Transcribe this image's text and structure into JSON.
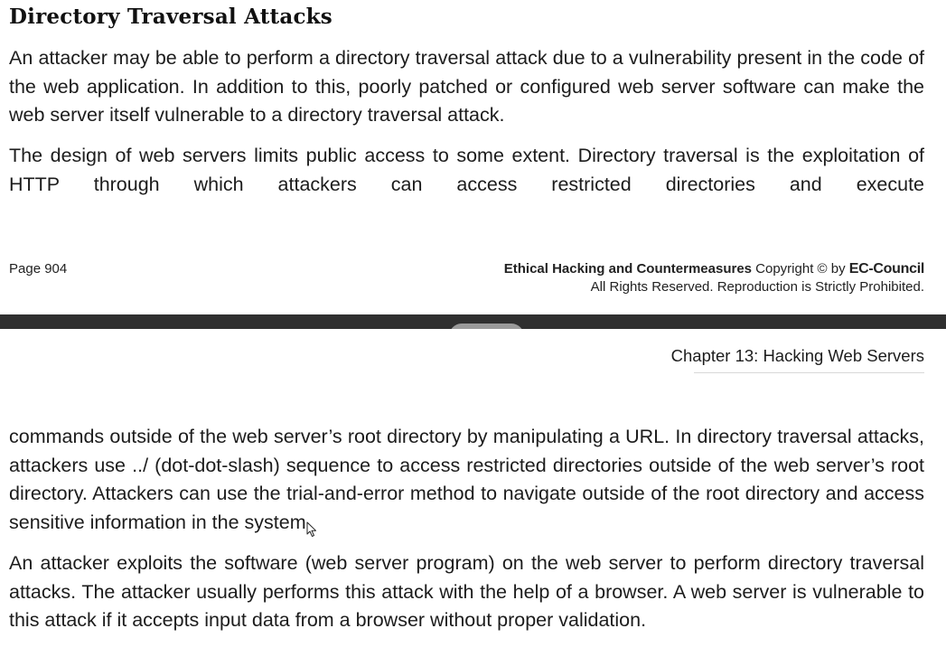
{
  "top_page": {
    "heading": "Directory Traversal Attacks",
    "paragraph_1": "An attacker may be able to perform a directory traversal attack due to a vulnerability present in the code of the web application. In addition to this, poorly patched or configured web server software can make the web server itself vulnerable to a directory traversal attack.",
    "paragraph_2": "The design of web servers limits public access to some extent. Directory traversal is the exploitation of HTTP through which attackers can access restricted directories and execute",
    "footer": {
      "page_number": "Page 904",
      "book_title": "Ethical Hacking and Countermeasures",
      "copyright_text": " Copyright © by ",
      "publisher": "EC-Council",
      "rights": "All Rights Reserved. Reproduction is Strictly Prohibited."
    }
  },
  "toolbar": {
    "icons": [
      "pin-icon",
      "mute-icon",
      "minus-circle-icon"
    ]
  },
  "bottom_page": {
    "chapter_header": "Chapter 13: Hacking Web Servers",
    "paragraph_3": "commands outside of the web server’s root directory by manipulating a URL. In directory traversal attacks, attackers use ../ (dot-dot-slash) sequence to access restricted directories outside of the web server’s root directory. Attackers can use the trial-and-error method to navigate outside of the root directory and access sensitive information in the system.",
    "paragraph_4": "An attacker exploits the software (web server program) on the web server to perform directory traversal attacks. The attacker usually performs this attack with the help of a browser. A web server is vulnerable to this attack if it accepts input data from a browser without proper validation."
  },
  "colors": {
    "separator": "#2f2f2f",
    "toolbar_bg": "#9a9a9a",
    "text": "#1c1c1c"
  }
}
